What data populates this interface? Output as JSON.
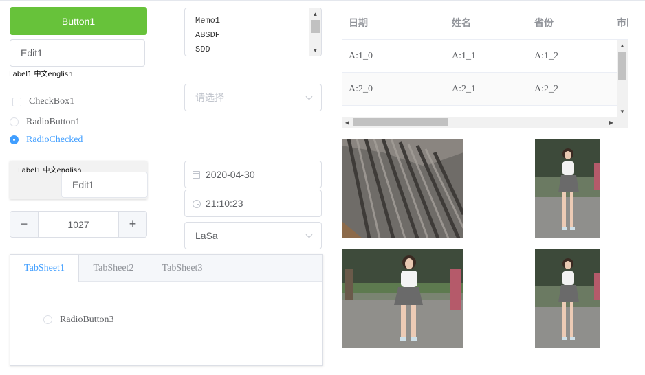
{
  "colors": {
    "accent": "#409eff",
    "success": "#67c23a",
    "border": "#dcdfe6"
  },
  "button1": {
    "label": "Button1"
  },
  "edit1": {
    "value": "Edit1"
  },
  "label1": {
    "text": "Label1 中文english"
  },
  "checkbox1": {
    "label": "CheckBox1",
    "checked": false
  },
  "radio1": {
    "label": "RadioButton1",
    "checked": false
  },
  "radio_checked": {
    "label": "RadioChecked",
    "checked": true
  },
  "panel": {
    "label": "Label1 中文english",
    "edit_value": "Edit1"
  },
  "stepper": {
    "value": "1027",
    "minus_icon": "minus-icon",
    "plus_icon": "plus-icon"
  },
  "memo": {
    "lines": [
      "Memo1",
      "ABSDF",
      "SDD"
    ]
  },
  "select_empty": {
    "placeholder": "请选择"
  },
  "date_picker": {
    "value": "2020-04-30",
    "icon": "calendar-icon"
  },
  "time_picker": {
    "value": "21:10:23",
    "icon": "clock-icon"
  },
  "select_city": {
    "value": "LaSa"
  },
  "tabs": {
    "items": [
      {
        "label": "TabSheet1",
        "active": true
      },
      {
        "label": "TabSheet2",
        "active": false
      },
      {
        "label": "TabSheet3",
        "active": false
      }
    ],
    "radio3": {
      "label": "RadioButton3",
      "checked": false
    }
  },
  "grid": {
    "columns": [
      "日期",
      "姓名",
      "省份",
      "市区"
    ],
    "rows": [
      [
        "A:1_0",
        "A:1_1",
        "A:1_2"
      ],
      [
        "A:2_0",
        "A:2_1",
        "A:2_2"
      ]
    ]
  },
  "images": [
    {
      "subject": "pleated gray skirt fabric closeup"
    },
    {
      "subject": "woman walking on street, white top, gray skirt"
    },
    {
      "subject": "woman walking on street, white top, gray skirt"
    },
    {
      "subject": "woman walking on street, white top, gray skirt"
    }
  ]
}
